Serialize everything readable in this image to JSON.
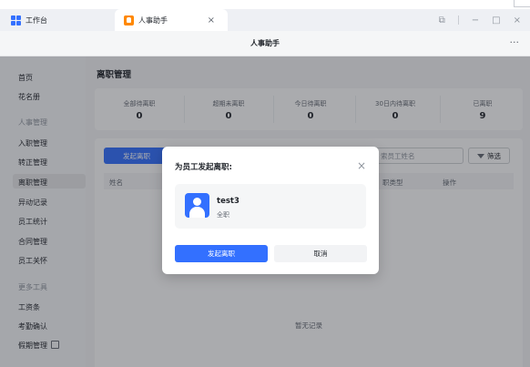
{
  "titlebar": {
    "tabs": [
      {
        "label": "工作台"
      },
      {
        "label": "人事助手",
        "close": "×"
      }
    ],
    "controls": {
      "restore": "⧉",
      "minimize": "−",
      "maximize": "□",
      "close": "×"
    }
  },
  "app": {
    "title": "人事助手",
    "more": "···"
  },
  "sidebar": {
    "items": [
      {
        "label": "首页"
      },
      {
        "label": "花名册"
      },
      {
        "label": "人事管理"
      },
      {
        "label": "入职管理"
      },
      {
        "label": "转正管理"
      },
      {
        "label": "离职管理"
      },
      {
        "label": "异动记录"
      },
      {
        "label": "员工统计"
      },
      {
        "label": "合同管理"
      },
      {
        "label": "员工关怀"
      },
      {
        "label": "更多工具"
      },
      {
        "label": "工资条"
      },
      {
        "label": "考勤确认"
      },
      {
        "label": "假期管理"
      }
    ]
  },
  "main": {
    "title": "离职管理",
    "stats": [
      {
        "label": "全部待离职",
        "value": "0"
      },
      {
        "label": "超期未离职",
        "value": "0"
      },
      {
        "label": "今日待离职",
        "value": "0"
      },
      {
        "label": "30日内待离职",
        "value": "0"
      },
      {
        "label": "已离职",
        "value": "9"
      }
    ],
    "start_button": "发起离职",
    "search_placeholder": "索员工姓名",
    "filter_label": "筛选",
    "columns": {
      "name": "姓名",
      "type": "职类型",
      "action": "操作"
    },
    "empty": "暂无记录"
  },
  "modal": {
    "title": "为员工发起离职:",
    "close": "×",
    "employee": {
      "name": "test3",
      "type": "全职"
    },
    "confirm": "发起离职",
    "cancel": "取消"
  },
  "colors": {
    "primary": "#3370ff",
    "tab_icon": "#ff8800"
  }
}
